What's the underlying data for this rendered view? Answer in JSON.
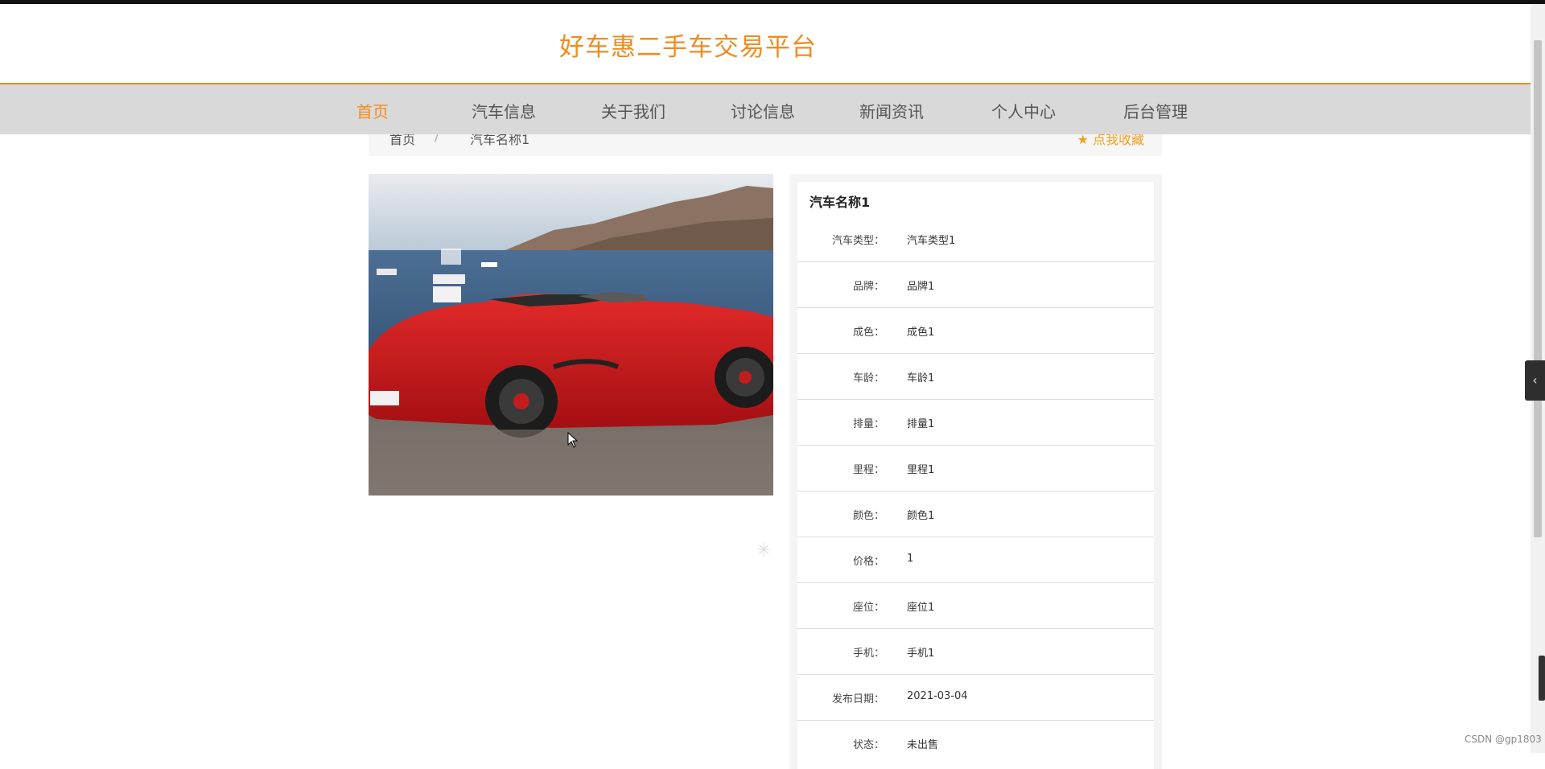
{
  "header": {
    "title": "好车惠二手车交易平台"
  },
  "nav": {
    "items": [
      {
        "label": "首页",
        "active": true
      },
      {
        "label": "汽车信息"
      },
      {
        "label": "关于我们"
      },
      {
        "label": "讨论信息"
      },
      {
        "label": "新闻资讯"
      },
      {
        "label": "个人中心"
      },
      {
        "label": "后台管理"
      }
    ]
  },
  "breadcrumb": {
    "home": "首页",
    "separator": "/",
    "current": "汽车名称1",
    "favorite": "点我收藏"
  },
  "detail": {
    "title": "汽车名称1",
    "rows": [
      {
        "label": "汽车类型：",
        "value": "汽车类型1"
      },
      {
        "label": "品牌：",
        "value": "品牌1"
      },
      {
        "label": "成色：",
        "value": "成色1"
      },
      {
        "label": "车龄：",
        "value": "车龄1"
      },
      {
        "label": "排量：",
        "value": "排量1"
      },
      {
        "label": "里程：",
        "value": "里程1"
      },
      {
        "label": "颜色：",
        "value": "颜色1"
      },
      {
        "label": "价格：",
        "value": "1"
      },
      {
        "label": "座位：",
        "value": "座位1"
      },
      {
        "label": "手机：",
        "value": "手机1"
      },
      {
        "label": "发布日期：",
        "value": "2021-03-04"
      },
      {
        "label": "状态：",
        "value": "未出售"
      }
    ]
  },
  "watermark": "CSDN @gp1803",
  "colors": {
    "accent": "#f08c1e",
    "nav_bg": "#d9d9d9"
  }
}
